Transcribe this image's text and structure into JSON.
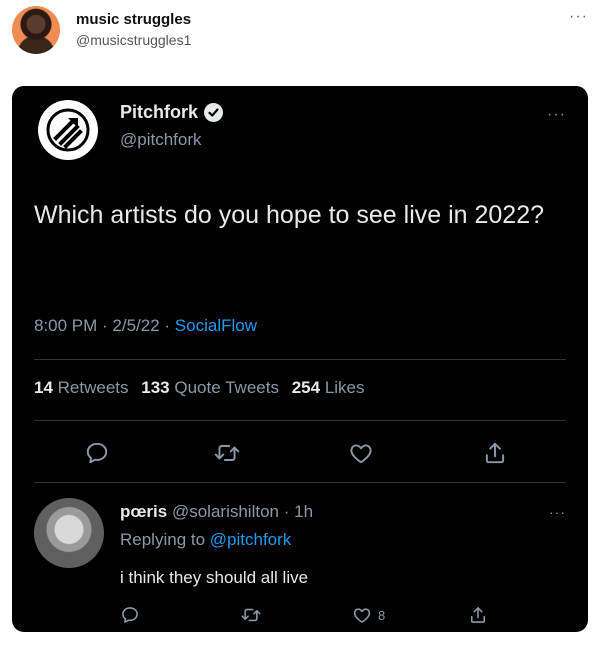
{
  "outer_tweet": {
    "name": "music struggles",
    "handle": "@musicstruggles1",
    "more": "···"
  },
  "quoted_tweet": {
    "name": "Pitchfork",
    "handle": "@pitchfork",
    "more": "···",
    "text": "Which artists do you hope to see live in 2022?",
    "time": "8:00 PM",
    "date": "2/5/22",
    "source": "SocialFlow",
    "separator": " · ",
    "stats": {
      "retweets_count": "14",
      "retweets_label": "Retweets",
      "quotes_count": "133",
      "quotes_label": "Quote Tweets",
      "likes_count": "254",
      "likes_label": "Likes"
    }
  },
  "reply": {
    "name": "pœris",
    "handle": "@solarishilton",
    "time": "· 1h",
    "replying_prefix": "Replying to ",
    "replying_to": "@pitchfork",
    "text": "i think they should all live",
    "like_count": "8",
    "more": "···"
  },
  "icons": {
    "verified": "verified-badge-icon",
    "reply": "reply-icon",
    "retweet": "retweet-icon",
    "like": "heart-icon",
    "share": "share-icon"
  },
  "colors": {
    "card_bg": "#000000",
    "link": "#1d9bf0",
    "muted": "#8b98a5",
    "text": "#e7e9ea"
  }
}
